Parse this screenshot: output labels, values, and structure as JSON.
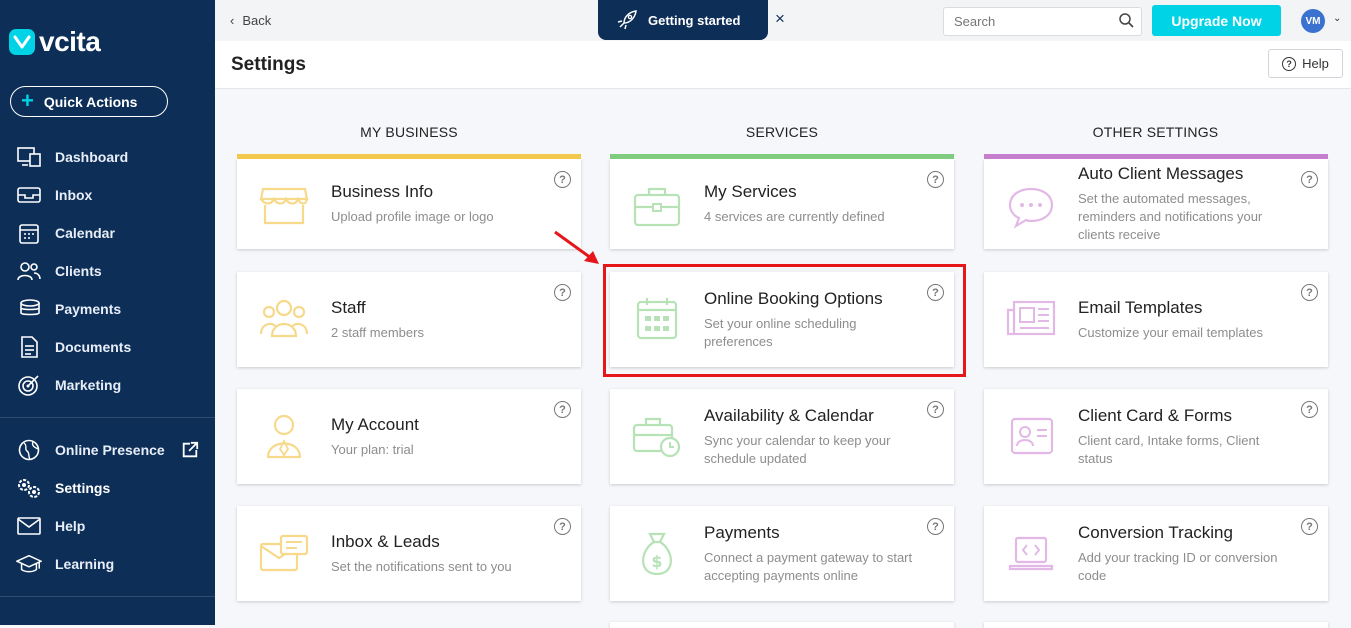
{
  "app": {
    "logo_text": "vcita"
  },
  "sidebar": {
    "quick_actions": "Quick Actions",
    "items": [
      {
        "label": "Dashboard",
        "icon": "dashboard-icon"
      },
      {
        "label": "Inbox",
        "icon": "inbox-icon"
      },
      {
        "label": "Calendar",
        "icon": "calendar-icon"
      },
      {
        "label": "Clients",
        "icon": "clients-icon"
      },
      {
        "label": "Payments",
        "icon": "payments-icon"
      },
      {
        "label": "Documents",
        "icon": "documents-icon"
      },
      {
        "label": "Marketing",
        "icon": "marketing-icon"
      }
    ],
    "items2": [
      {
        "label": "Online Presence",
        "icon": "globe-icon"
      },
      {
        "label": "Settings",
        "icon": "settings-icon"
      },
      {
        "label": "Help",
        "icon": "help-icon"
      },
      {
        "label": "Learning",
        "icon": "learning-icon"
      }
    ]
  },
  "topbar": {
    "back": "Back",
    "getting_started": "Getting started",
    "close": "×",
    "search_placeholder": "Search",
    "upgrade": "Upgrade Now",
    "avatar": "VM"
  },
  "header": {
    "title": "Settings",
    "help": "Help"
  },
  "columns": [
    {
      "heading": "MY BUSINESS",
      "color": "#f2c94c",
      "icon_color": "#f6d98a"
    },
    {
      "heading": "SERVICES",
      "color": "#7fcc7f",
      "icon_color": "#b6e2b6"
    },
    {
      "heading": "OTHER SETTINGS",
      "color": "#c67fcf",
      "icon_color": "#e2b9e6"
    }
  ],
  "cards": {
    "my_business": [
      {
        "title": "Business Info",
        "desc": "Upload profile image or logo"
      },
      {
        "title": "Staff",
        "desc": "2 staff members"
      },
      {
        "title": "My Account",
        "desc": "Your plan: trial"
      },
      {
        "title": "Inbox & Leads",
        "desc": "Set the notifications sent to you"
      }
    ],
    "services": [
      {
        "title": "My Services",
        "desc": "4 services are currently defined"
      },
      {
        "title": "Online Booking Options",
        "desc": "Set your online scheduling preferences"
      },
      {
        "title": "Availability & Calendar",
        "desc": "Sync your calendar to keep your schedule updated"
      },
      {
        "title": "Payments",
        "desc": "Connect a payment gateway to start accepting payments online"
      }
    ],
    "other": [
      {
        "title": "Auto Client Messages",
        "desc": "Set the automated messages, reminders and notifications your clients receive"
      },
      {
        "title": "Email Templates",
        "desc": "Customize your email templates"
      },
      {
        "title": "Client Card & Forms",
        "desc": "Client card, Intake forms, Client status"
      },
      {
        "title": "Conversion Tracking",
        "desc": "Add your tracking ID or conversion code"
      }
    ]
  },
  "help_mark": "?"
}
